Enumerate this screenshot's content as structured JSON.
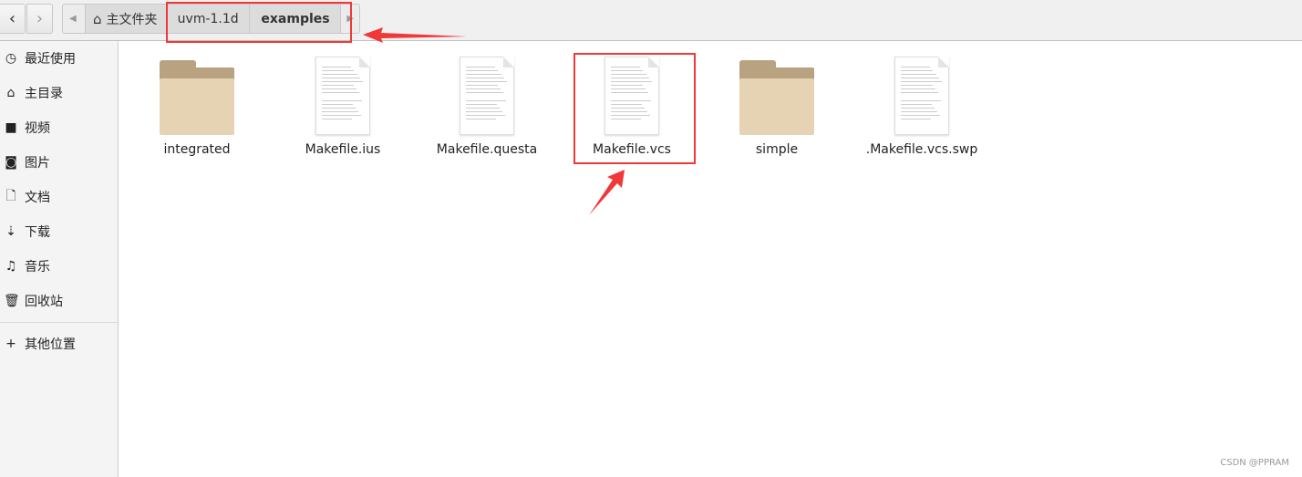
{
  "toolbar": {
    "back_icon": "chevron-left-icon",
    "forward_icon": "chevron-right-icon",
    "breadcrumbs": [
      {
        "label": "主文件夹",
        "icon": "home-icon"
      },
      {
        "label": "uvm-1.1d"
      },
      {
        "label": "examples",
        "active": true
      }
    ]
  },
  "sidebar": {
    "items": [
      {
        "label": "最近使用",
        "icon": "clock-icon"
      },
      {
        "label": "主目录",
        "icon": "home-icon"
      },
      {
        "label": "视频",
        "icon": "video-icon"
      },
      {
        "label": "图片",
        "icon": "camera-icon"
      },
      {
        "label": "文档",
        "icon": "document-icon"
      },
      {
        "label": "下载",
        "icon": "download-icon"
      },
      {
        "label": "音乐",
        "icon": "music-icon"
      },
      {
        "label": "回收站",
        "icon": "trash-icon"
      }
    ],
    "other": {
      "label": "其他位置",
      "icon": "plus-icon"
    }
  },
  "files": [
    {
      "name": "integrated",
      "type": "folder"
    },
    {
      "name": "Makefile.ius",
      "type": "file"
    },
    {
      "name": "Makefile.questa",
      "type": "file"
    },
    {
      "name": "Makefile.vcs",
      "type": "file",
      "highlighted": true
    },
    {
      "name": "simple",
      "type": "folder"
    },
    {
      "name": ".Makefile.vcs.swp",
      "type": "file"
    }
  ],
  "annotation_color": "#f03838",
  "watermark": "CSDN @PPRAM"
}
